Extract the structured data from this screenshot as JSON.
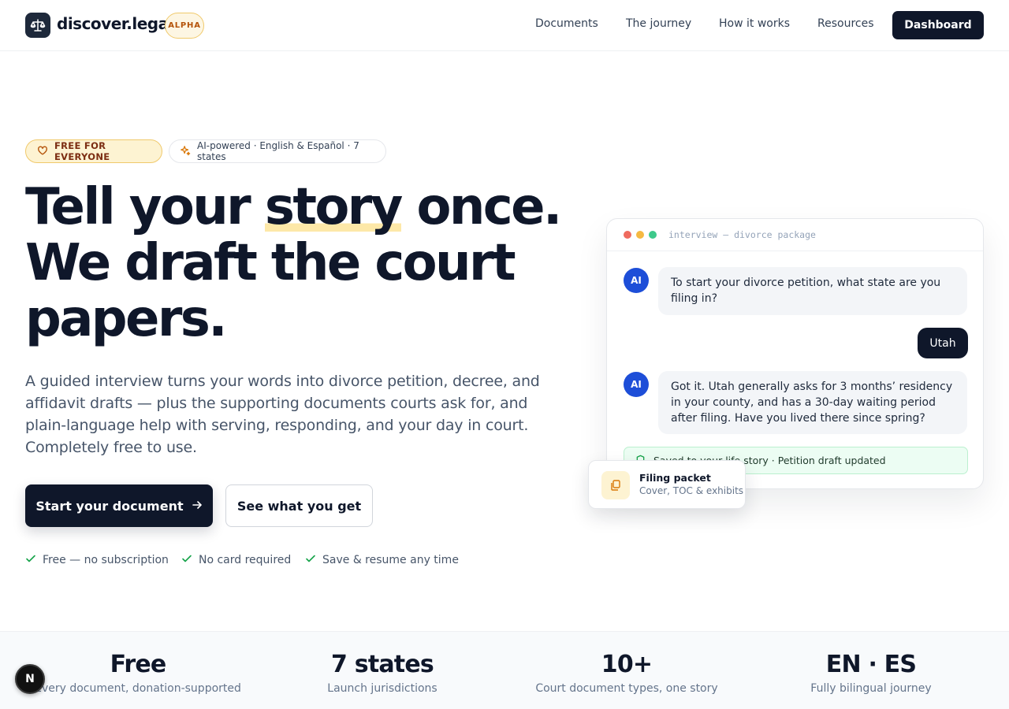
{
  "header": {
    "brand": "discover.legal",
    "badge": "ALPHA",
    "nav": [
      "Documents",
      "The journey",
      "How it works",
      "Resources"
    ],
    "dashboard_label": "Dashboard"
  },
  "hero": {
    "pill_free": "FREE FOR EVERYONE",
    "pill_ai": "AI-powered · English & Español · 7 states",
    "headline": {
      "part1": "Tell your ",
      "highlight": "story",
      "part2": " once.",
      "line2": "We draft the court",
      "line3": "papers."
    },
    "lede": "A guided interview turns your words into divorce petition, decree, and affidavit drafts — plus the supporting documents courts ask for, and plain-language help with serving, responding, and your day in court. Completely free to use.",
    "primary_cta": "Start your document",
    "secondary_cta": "See what you get",
    "checks": [
      "Free — no subscription",
      "No card required",
      "Save & resume any time"
    ]
  },
  "chat": {
    "title": "interview — divorce package",
    "avatar_label": "AI",
    "messages": [
      {
        "role": "ai",
        "text": "To start your divorce petition, what state are you filing in?"
      },
      {
        "role": "user",
        "text": "Utah"
      },
      {
        "role": "ai",
        "text": "Got it. Utah generally asks for 3 months’ residency in your county, and has a 30-day waiting period after filing. Have you lived there since spring?"
      }
    ],
    "saved_text": "Saved to your life story · Petition draft updated"
  },
  "packet": {
    "title": "Filing packet",
    "subtitle": "Cover, TOC & exhibits"
  },
  "stats": [
    {
      "value": "Free",
      "label": "Every document, donation-supported"
    },
    {
      "value": "7 states",
      "label": "Launch jurisdictions"
    },
    {
      "value": "10+",
      "label": "Court document types, one story"
    },
    {
      "value": "EN · ES",
      "label": "Fully bilingual journey"
    }
  ],
  "dev_badge": "N",
  "colors": {
    "dark": "#0f172a",
    "accent_yellow": "#fde8a8",
    "ai_blue": "#1d4ed8",
    "success_green": "#ecfdf3"
  }
}
